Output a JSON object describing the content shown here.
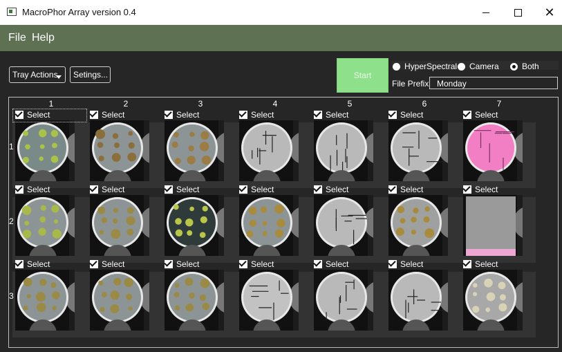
{
  "window": {
    "title": "MacroPhor Array version 0.4",
    "min_label": "",
    "close_label": "✕"
  },
  "menu": {
    "file": "File",
    "help": "Help"
  },
  "controls": {
    "tray_actions": "Tray Actions",
    "settings": "Setings...",
    "start": "Start",
    "radio_options": [
      {
        "label": "HyperSpectral",
        "checked": false
      },
      {
        "label": "Camera",
        "checked": false
      },
      {
        "label": "Both",
        "checked": true
      }
    ],
    "file_prefix_label": "File Prefix",
    "file_prefix_value": "Monday"
  },
  "array": {
    "columns": [
      "1",
      "2",
      "3",
      "4",
      "5",
      "6",
      "7"
    ],
    "rows": [
      "1",
      "2",
      "3"
    ],
    "select_label": "Select",
    "cells": [
      [
        {
          "type": "plate",
          "fill": "#7a8a88",
          "plants": "#a9c34a"
        },
        {
          "type": "plate",
          "fill": "#8c9496",
          "plants": "#8a6f3c"
        },
        {
          "type": "plate",
          "fill": "#8c9496",
          "plants": "#9b7c45"
        },
        {
          "type": "grey",
          "fill": "#b9b9b9"
        },
        {
          "type": "grey",
          "fill": "#b9b9b9"
        },
        {
          "type": "grey",
          "fill": "#b9b9b9"
        },
        {
          "type": "pink",
          "fill": "#f27fc3"
        }
      ],
      [
        {
          "type": "plate",
          "fill": "#8c9496",
          "plants": "#a7b94a"
        },
        {
          "type": "plate",
          "fill": "#8c9496",
          "plants": "#9b8a45"
        },
        {
          "type": "plate",
          "fill": "#2f3a3a",
          "plants": "#b9c64a"
        },
        {
          "type": "plate",
          "fill": "#8c9496",
          "plants": "#a88b3c"
        },
        {
          "type": "grey",
          "fill": "#b9b9b9"
        },
        {
          "type": "plate",
          "fill": "#9fa0a0",
          "plants": "#a88b3c"
        },
        {
          "type": "flat",
          "fill": "#9a9a9a"
        }
      ],
      [
        {
          "type": "plate",
          "fill": "#8c9496",
          "plants": "#9b8a45"
        },
        {
          "type": "plate",
          "fill": "#8c9496",
          "plants": "#9b8a45"
        },
        {
          "type": "plate",
          "fill": "#8c9496",
          "plants": "#9b8a45"
        },
        {
          "type": "grey",
          "fill": "#c2c2c2"
        },
        {
          "type": "grey",
          "fill": "#b9b9b9"
        },
        {
          "type": "grey",
          "fill": "#b9b9b9"
        },
        {
          "type": "plate",
          "fill": "#a8a8a8",
          "plants": "#d8d2b6"
        }
      ]
    ]
  },
  "colors": {
    "menubar": "#5e7153",
    "start_button": "#8ee08b",
    "background": "#262626"
  }
}
